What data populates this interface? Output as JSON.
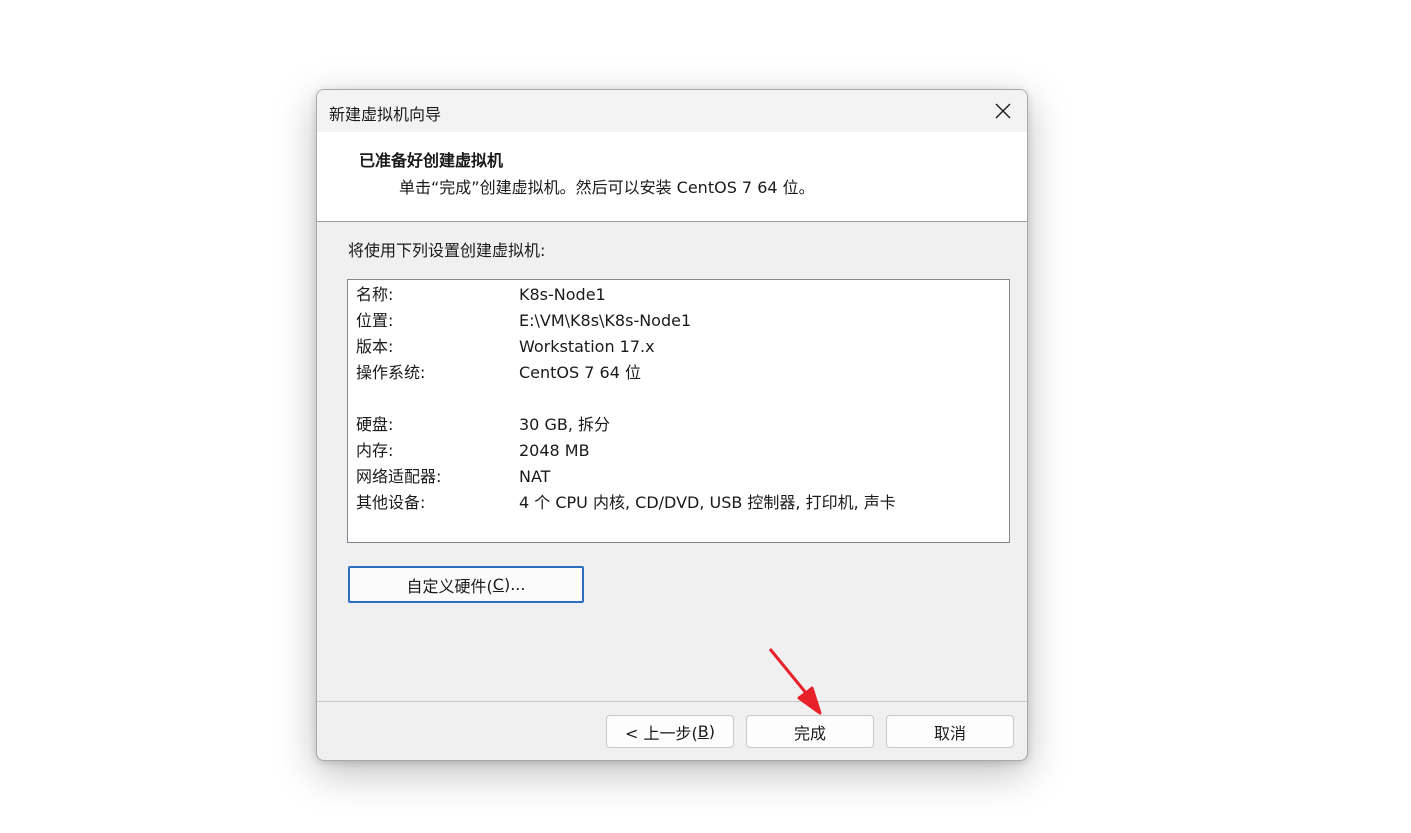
{
  "window": {
    "title": "新建虚拟机向导",
    "close_label": "关闭"
  },
  "header": {
    "title": "已准备好创建虚拟机",
    "subtitle": "单击“完成”创建虚拟机。然后可以安装 CentOS 7 64 位。"
  },
  "body": {
    "intro": "将使用下列设置创建虚拟机:"
  },
  "summary": {
    "rows": [
      {
        "key": "名称:",
        "value": "K8s-Node1"
      },
      {
        "key": "位置:",
        "value": "E:\\VM\\K8s\\K8s-Node1"
      },
      {
        "key": "版本:",
        "value": "Workstation 17.x"
      },
      {
        "key": "操作系统:",
        "value": "CentOS 7 64 位"
      },
      {
        "key": "硬盘:",
        "value": "30 GB, 拆分"
      },
      {
        "key": "内存:",
        "value": "2048 MB"
      },
      {
        "key": "网络适配器:",
        "value": "NAT"
      },
      {
        "key": "其他设备:",
        "value": "4 个 CPU 内核, CD/DVD, USB 控制器, 打印机, 声卡"
      }
    ]
  },
  "buttons": {
    "customize": {
      "prefix": "自定义硬件(",
      "mnemonic": "C",
      "suffix": ")..."
    },
    "back": {
      "prefix": "< 上一步(",
      "mnemonic": "B",
      "suffix": ")"
    },
    "finish": "完成",
    "cancel": "取消"
  },
  "colors": {
    "accent": "#2a6dc1",
    "annotation_arrow": "#e8202a"
  }
}
